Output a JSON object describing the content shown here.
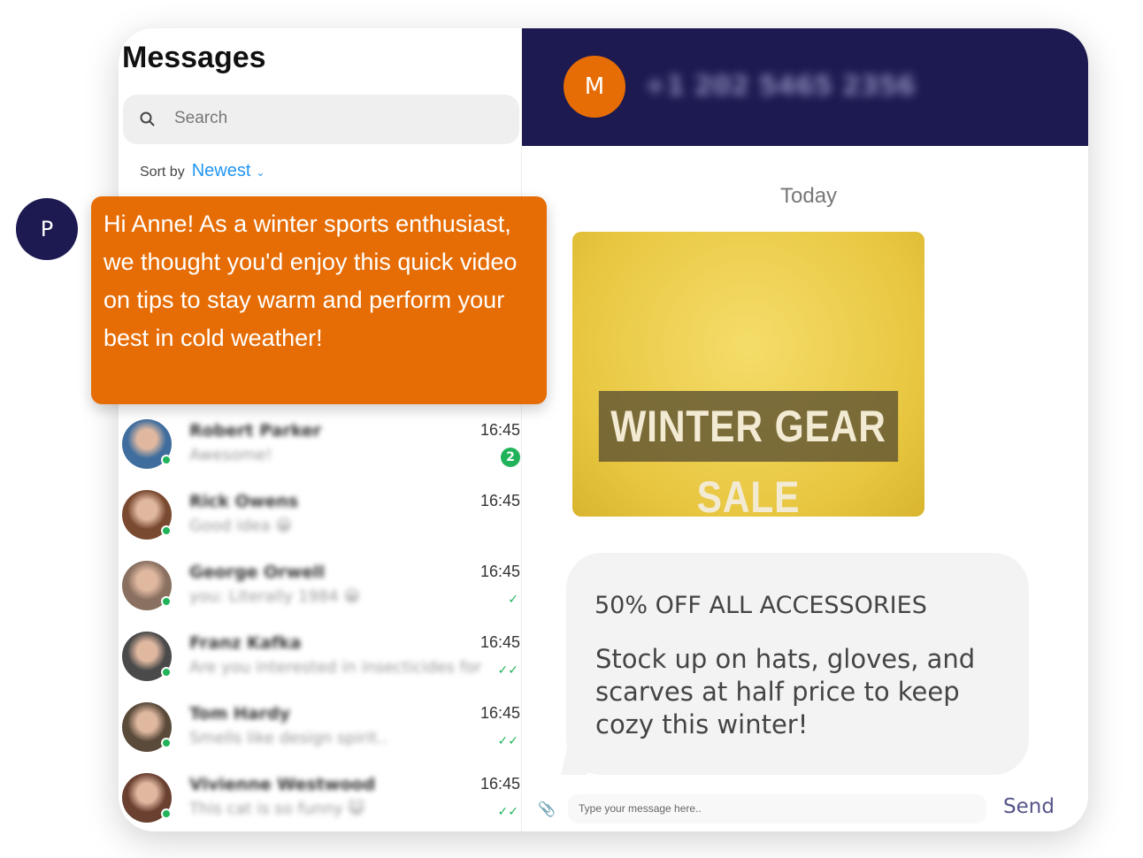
{
  "sidebar": {
    "title": "Messages",
    "search_placeholder": "Search",
    "sort_label": "Sort by",
    "sort_value": "Newest",
    "conversations": [
      {
        "name": "Robert Parker",
        "preview": "Awesome!",
        "time": "16:45",
        "unread": "2",
        "status": "unread",
        "avatar_color": "#3f6e9e"
      },
      {
        "name": "Rick Owens",
        "preview": "Good idea 😀",
        "time": "16:45",
        "status": "none",
        "avatar_color": "#7a4a30"
      },
      {
        "name": "George Orwell",
        "preview": "you: Literally 1984 😀",
        "time": "16:45",
        "status": "sent",
        "avatar_color": "#8a7060"
      },
      {
        "name": "Franz Kafka",
        "preview": "Are you interested in insecticides for..",
        "time": "16:45",
        "status": "read",
        "avatar_color": "#4a4a4a"
      },
      {
        "name": "Tom Hardy",
        "preview": "Smells like design spirit..",
        "time": "16:45",
        "status": "read",
        "avatar_color": "#5a4a3a"
      },
      {
        "name": "Vivienne Westwood",
        "preview": "This cat is so funny 😺",
        "time": "16:45",
        "status": "read",
        "avatar_color": "#6a4030"
      }
    ]
  },
  "chat": {
    "contact_initial": "M",
    "contact_phone": "+1 202 5465 2356",
    "day_label": "Today",
    "image_caption": "WINTER GEAR SALE",
    "message_heading": "50% OFF ALL ACCESSORIES",
    "message_body": "Stock up on hats, gloves, and scarves at half price to keep cozy this winter!",
    "input_placeholder": "Type your message here..",
    "send_label": "Send"
  },
  "overlay": {
    "initial": "P",
    "message": "Hi Anne! As a winter sports enthusiast, we thought you'd enjoy this quick video on tips to stay warm and perform your best in cold weather!"
  },
  "colors": {
    "navy": "#1c1a50",
    "orange": "#e66d05",
    "online": "#21b35a",
    "link": "#2196f3"
  }
}
